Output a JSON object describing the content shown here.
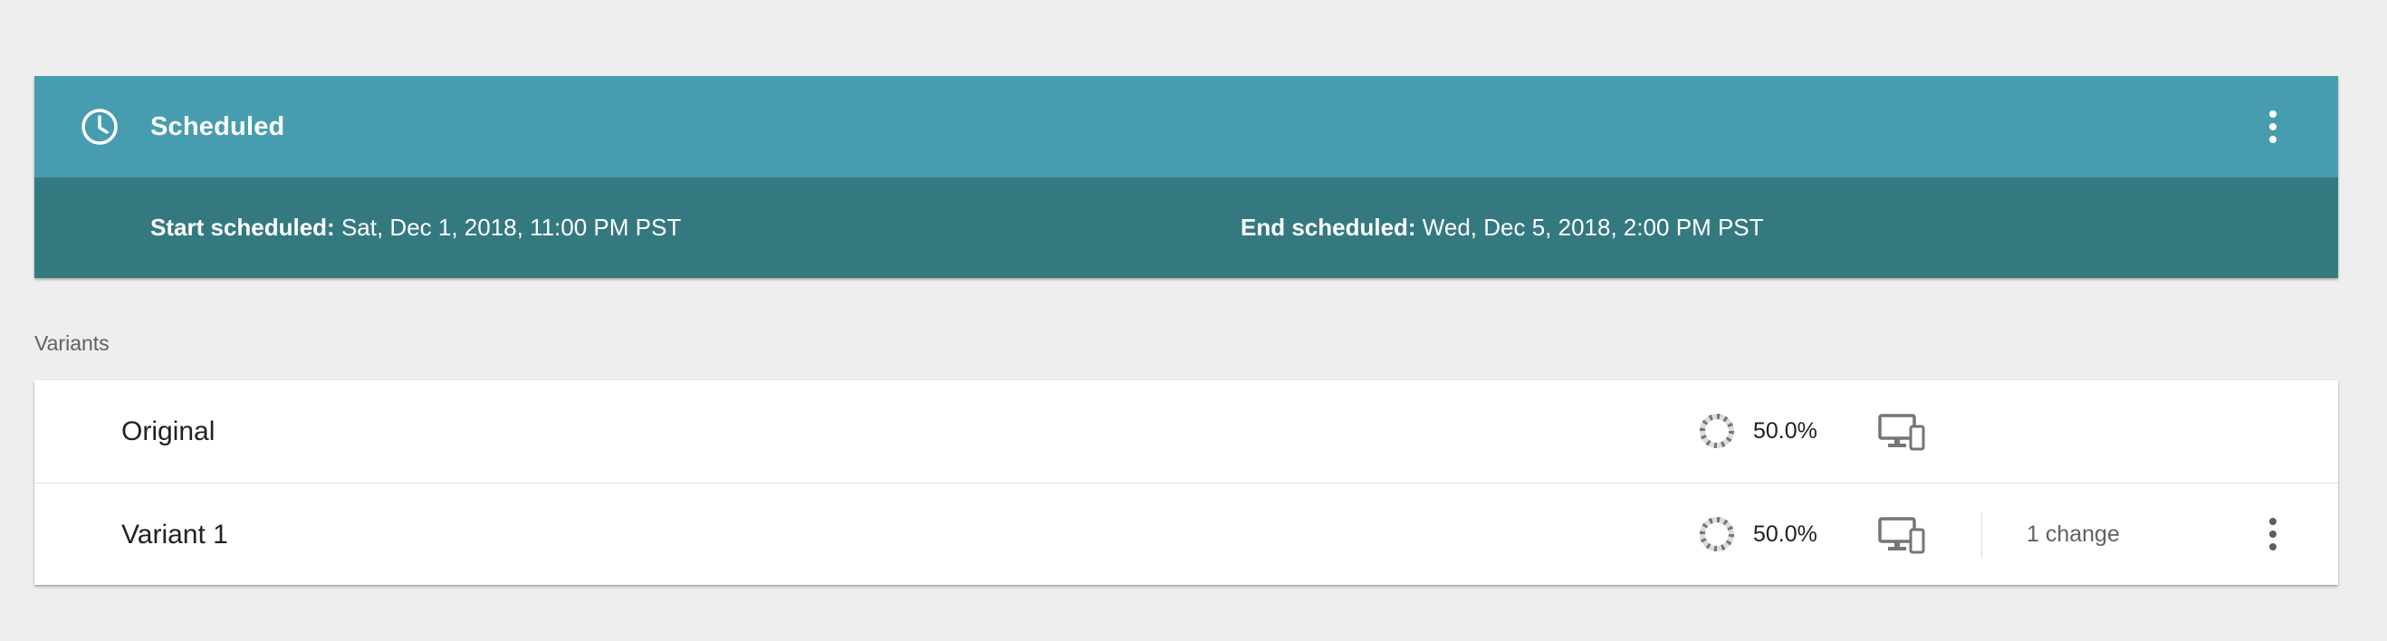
{
  "scheduled": {
    "title": "Scheduled",
    "start_label": "Start scheduled:",
    "start_value": " Sat, Dec 1, 2018, 11:00 PM PST",
    "end_label": "End scheduled:",
    "end_value": " Wed, Dec 5, 2018, 2:00 PM PST",
    "icons": {
      "status": "clock-icon",
      "menu": "more-vert-icon"
    },
    "colors": {
      "header": "#479daf",
      "subheader": "#347980"
    }
  },
  "variants": {
    "label": "Variants",
    "items": [
      {
        "name": "Original",
        "traffic": "50.0%",
        "traffic_fraction": 0.5,
        "device_icon": "desktop-mobile-icon"
      },
      {
        "name": "Variant 1",
        "traffic": "50.0%",
        "traffic_fraction": 0.5,
        "device_icon": "desktop-mobile-icon",
        "changes": "1 change"
      }
    ]
  }
}
